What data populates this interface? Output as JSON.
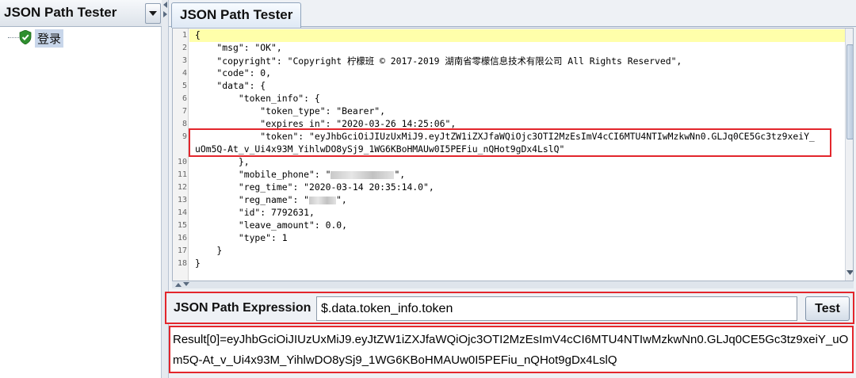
{
  "left_panel": {
    "title": "JSON Path Tester",
    "tree_item": "登录"
  },
  "tab": {
    "label": "JSON Path Tester"
  },
  "editor": {
    "line_numbers": [
      "1",
      "2",
      "3",
      "4",
      "5",
      "6",
      "7",
      "8",
      "9",
      "",
      "10",
      "11",
      "12",
      "13",
      "14",
      "15",
      "16",
      "17",
      "18"
    ],
    "lines": {
      "l1": "{",
      "l2": "    \"msg\": \"OK\",",
      "l3": "    \"copyright\": \"Copyright 柠檬班 © 2017-2019 湖南省零檬信息技术有限公司 All Rights Reserved\",",
      "l4": "    \"code\": 0,",
      "l5": "    \"data\": {",
      "l6": "        \"token_info\": {",
      "l7": "            \"token_type\": \"Bearer\",",
      "l8": "            \"expires_in\": \"2020-03-26 14:25:06\",",
      "l9a": "            \"token\": \"eyJhbGciOiJIUzUxMiJ9.eyJtZW1iZXJfaWQiOjc3OTI2MzEsImV4cCI6MTU4NTIwMzkwNn0.GLJq0CE5Gc3tz9xeiY_",
      "l9b": "uOm5Q-At_v_Ui4x93M_YihlwDO8ySj9_1WG6KBoHMAUw0I5PEFiu_nQHot9gDx4LslQ\"",
      "l10": "        },",
      "l11_prefix": "        \"mobile_phone\": \"",
      "l11_suffix": "\",",
      "l12": "        \"reg_time\": \"2020-03-14 20:35:14.0\",",
      "l13_prefix": "        \"reg_name\": \"",
      "l13_suffix": "\",",
      "l14": "        \"id\": 7792631,",
      "l15": "        \"leave_amount\": 0.0,",
      "l16": "        \"type\": 1",
      "l17": "    }",
      "l18": "}"
    }
  },
  "expression": {
    "label": "JSON Path Expression",
    "value": "$.data.token_info.token",
    "button": "Test"
  },
  "result": {
    "text": "Result[0]=eyJhbGciOiJIUzUxMiJ9.eyJtZW1iZXJfaWQiOjc3OTI2MzEsImV4cCI6MTU4NTIwMzkwNn0.GLJq0CE5Gc3tz9xeiY_uOm5Q-At_v_Ui4x93M_YihlwDO8ySj9_1WG6KBoHMAUw0I5PEFiu_nQHot9gDx4LslQ"
  },
  "colors": {
    "highlight_red": "#e3262c",
    "current_line": "#ffffaa",
    "selection": "#c8d6ea"
  },
  "icons": [
    "chevron-down-icon",
    "shield-check-icon",
    "splitter-left-arrow-icon",
    "splitter-right-arrow-icon",
    "splitter-up-arrow-icon",
    "splitter-down-arrow-icon",
    "scroll-down-arrow-icon"
  ]
}
